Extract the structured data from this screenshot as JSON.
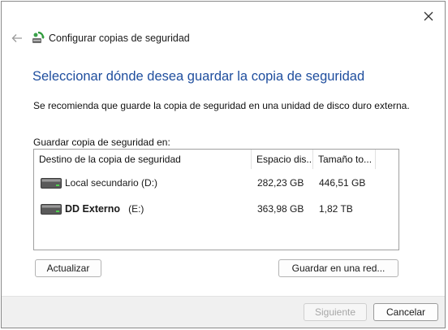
{
  "window": {
    "title": "Configurar copias de seguridad",
    "close_icon": "close-icon",
    "back_icon": "back-arrow-icon",
    "app_icon": "backup-icon"
  },
  "main": {
    "heading": "Seleccionar dónde desea guardar la copia de seguridad",
    "recommendation": "Se recomienda que guarde la copia de seguridad en una unidad de disco duro externa.",
    "list_label": "Guardar copia de seguridad en:"
  },
  "table": {
    "columns": [
      "Destino de la copia de seguridad",
      "Espacio dis...",
      "Tamaño to..."
    ],
    "rows": [
      {
        "name": "Local secundario (D:)",
        "free": "282,23 GB",
        "total": "446,51 GB",
        "icon": "drive-icon"
      },
      {
        "name": "DD Externo",
        "letter": "(E:)",
        "free": "363,98 GB",
        "total": "1,82 TB",
        "icon": "drive-icon"
      }
    ]
  },
  "buttons": {
    "refresh": "Actualizar",
    "save_network": "Guardar en una red...",
    "next": "Siguiente",
    "cancel": "Cancelar"
  },
  "colors": {
    "heading": "#1f4e9e",
    "footer_bg": "#f0f0f0",
    "disabled_text": "#a7a7a7"
  }
}
